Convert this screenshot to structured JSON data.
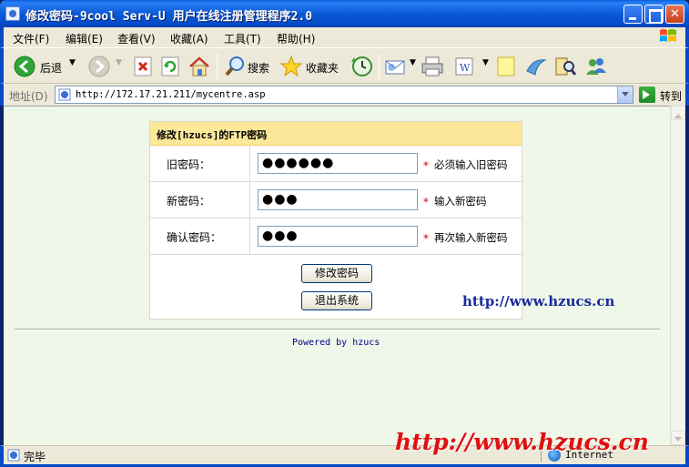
{
  "window": {
    "title": "修改密码-9cool Serv-U 用户在线注册管理程序2.0"
  },
  "menu": [
    "文件(F)",
    "编辑(E)",
    "查看(V)",
    "收藏(A)",
    "工具(T)",
    "帮助(H)"
  ],
  "toolbar": {
    "back_label": "后退",
    "search_label": "搜索",
    "favorites_label": "收藏夹"
  },
  "address": {
    "label": "地址(D)",
    "url": "http://172.17.21.211/mycentre.asp",
    "go_label": "转到"
  },
  "form": {
    "title": "修改[hzucs]的FTP密码",
    "rows": [
      {
        "label": "旧密码：",
        "value": "●●●●●●",
        "required_mark": "*",
        "hint": "必须输入旧密码"
      },
      {
        "label": "新密码：",
        "value": "●●●",
        "required_mark": "*",
        "hint": "输入新密码"
      },
      {
        "label": "确认密码：",
        "value": "●●●",
        "required_mark": "*",
        "hint": "再次输入新密码"
      }
    ],
    "submit_label": "修改密码",
    "logout_label": "退出系统"
  },
  "footer": {
    "powered": "Powered by hzucs"
  },
  "watermark": {
    "blue": "http://www.hzucs.cn",
    "red": "http://www.hzucs.cn"
  },
  "status": {
    "text": "完毕",
    "zone": "Internet"
  },
  "colors": {
    "titlebar": "#0549c8",
    "header_bg": "#fde89a",
    "page_bg": "#eef7e8",
    "required": "#d00000",
    "watermark_red": "#e01010",
    "watermark_blue": "#1a2a9c"
  }
}
